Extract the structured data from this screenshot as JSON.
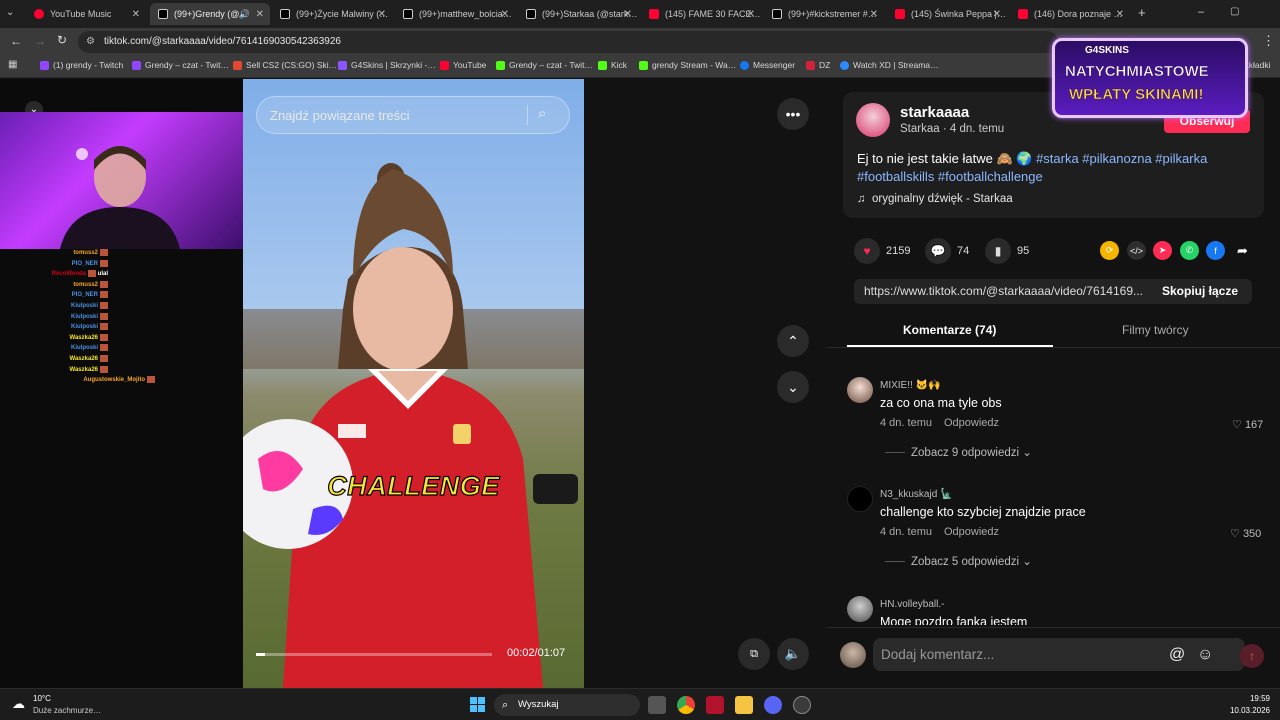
{
  "tabs": [
    {
      "label": "YouTube Music",
      "color": "#ff0033"
    },
    {
      "label": "(99+)Grendy (@…",
      "color": "#ffffff"
    },
    {
      "label": "(99+)Życie Malwiny (…",
      "color": "#ffffff"
    },
    {
      "label": "(99+)matthew_bolcia…",
      "color": "#ffffff"
    },
    {
      "label": "(99+)Starkaa (@stark…",
      "color": "#ffffff"
    },
    {
      "label": "(145) FAME 30 FACE…",
      "color": "#ff0033"
    },
    {
      "label": "(99+)#kickstremer #…",
      "color": "#ffffff"
    },
    {
      "label": "(145) Świnka Peppa |…",
      "color": "#ff0033"
    },
    {
      "label": "(146) Dora poznaje …",
      "color": "#ff0033"
    }
  ],
  "url": "tiktok.com/@starkaaaa/video/7614169030542363926",
  "bookmarks": [
    {
      "label": "(1) grendy - Twitch",
      "color": "#9146ff"
    },
    {
      "label": "Grendy – czat - Twit…",
      "color": "#9146ff"
    },
    {
      "label": "Sell CS2 (CS:GO) Ski…",
      "color": "#e0492f"
    },
    {
      "label": "G4Skins | Skrzynki -…",
      "color": "#8a55ff"
    },
    {
      "label": "YouTube",
      "color": "#ff0033"
    },
    {
      "label": "Grendy – czat - Twit…",
      "color": "#53fc18"
    },
    {
      "label": "Kick",
      "color": "#53fc18"
    },
    {
      "label": "grendy Stream - Wa…",
      "color": "#53fc18"
    },
    {
      "label": "Messenger",
      "color": "#1877f2"
    },
    {
      "label": "DZ",
      "color": "#d0223a"
    },
    {
      "label": "Watch XD | Streama…",
      "color": "#2b8cff"
    },
    {
      "label": "akładki",
      "color": "#888888"
    }
  ],
  "chat": [
    {
      "name": "tomuss2",
      "color": "#f5a623"
    },
    {
      "name": "PIO_NER",
      "color": "#4a90e2"
    },
    {
      "name": "RecoWenda",
      "color": "#d0021b",
      "msg": "ulal"
    },
    {
      "name": "tomuss2",
      "color": "#f5a623"
    },
    {
      "name": "PIO_NER",
      "color": "#4a90e2"
    },
    {
      "name": "Kiulposki",
      "color": "#4a90e2"
    },
    {
      "name": "Kiulposki",
      "color": "#4a90e2"
    },
    {
      "name": "Kiulposki",
      "color": "#4a90e2"
    },
    {
      "name": "Waszka26",
      "color": "#f8e71c"
    },
    {
      "name": "Kiulposki",
      "color": "#4a90e2"
    },
    {
      "name": "Waszka26",
      "color": "#f8e71c"
    },
    {
      "name": "Waszka26",
      "color": "#f8e71c"
    },
    {
      "name": "Augustowskie_Mojito",
      "color": "#f5a623"
    }
  ],
  "video": {
    "search_placeholder": "Znajdź powiązane treści",
    "caption": "CHALLENGE",
    "time": "00:02/01:07",
    "progress": 0.04
  },
  "post": {
    "username": "starkaaaa",
    "display": "Starkaa · 4 dn. temu",
    "follow": "Obserwuj",
    "description_text": "Ej to nie jest takie łatwe 🙈 🌍 ",
    "hashtags": "#starka #pilkanozna #pilkarka #footballskills #footballchallenge",
    "sound": "oryginalny dźwięk - Starkaa",
    "likes": "2159",
    "comments": "74",
    "saves": "95",
    "link": "https://www.tiktok.com/@starkaaaa/video/7614169...",
    "copy": "Skopiuj łącze"
  },
  "panel_tabs": {
    "comments": "Komentarze (74)",
    "creator": "Filmy twórcy"
  },
  "comments": [
    {
      "name": "MIXIE!! 🐱🙌",
      "text": "za co ona ma tyle obs",
      "time": "4 dn. temu",
      "reply": "Odpowiedz",
      "likes": "167",
      "more": "Zobacz 9 odpowiedzi"
    },
    {
      "name": "N3_kkuskajd 🗽",
      "text": "challenge kto szybciej znajdzie prace",
      "time": "4 dn. temu",
      "reply": "Odpowiedz",
      "likes": "350",
      "more": "Zobacz 5 odpowiedzi"
    },
    {
      "name": "HN.volleyball.-",
      "text": "Moge pozdro fanka jestem"
    }
  ],
  "comment_placeholder": "Dodaj komentarz...",
  "promo": {
    "brand": "G4SKINS",
    "line1": "NATYCHMIASTOWE",
    "line2": "WPŁATY SKINAMI!"
  },
  "taskbar": {
    "temp": "10°C",
    "weather": "Duże zachmurze…",
    "search": "Wyszukaj",
    "time": "19:59",
    "date": "10.03.2026"
  }
}
